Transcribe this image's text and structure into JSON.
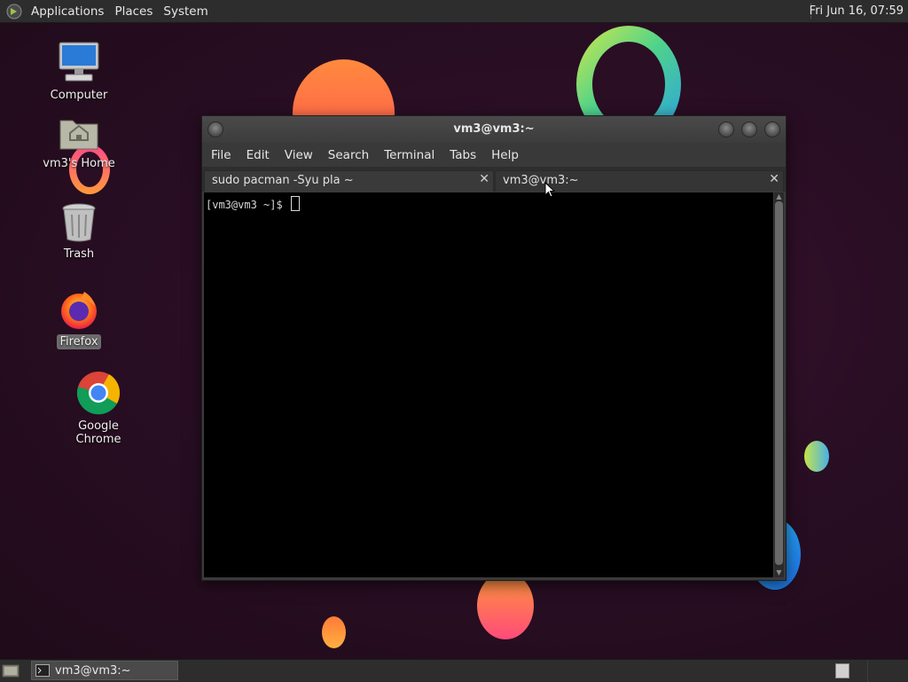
{
  "top_panel": {
    "menus": [
      "Applications",
      "Places",
      "System"
    ],
    "clock": "Fri Jun 16, 07:59"
  },
  "desktop_icons": [
    {
      "label": "Computer",
      "icon": "computer-icon"
    },
    {
      "label": "vm3's Home",
      "icon": "home-folder-icon"
    },
    {
      "label": "Trash",
      "icon": "trash-icon"
    },
    {
      "label": "Firefox",
      "icon": "firefox-icon",
      "selected": true
    },
    {
      "label": "Google Chrome",
      "icon": "chrome-icon"
    }
  ],
  "terminal": {
    "title": "vm3@vm3:~",
    "menu": [
      "File",
      "Edit",
      "View",
      "Search",
      "Terminal",
      "Tabs",
      "Help"
    ],
    "tabs": [
      {
        "label": "sudo pacman -Syu pla ~",
        "close": "✕"
      },
      {
        "label": "vm3@vm3:~",
        "close": "✕"
      }
    ],
    "prompt": "[vm3@vm3 ~]$ "
  },
  "taskbar": {
    "window_label": "vm3@vm3:~"
  },
  "colors": {
    "panel": "#2d2d2d",
    "terminal_bg": "#000000",
    "desktop_bg": "#2a0e24"
  }
}
